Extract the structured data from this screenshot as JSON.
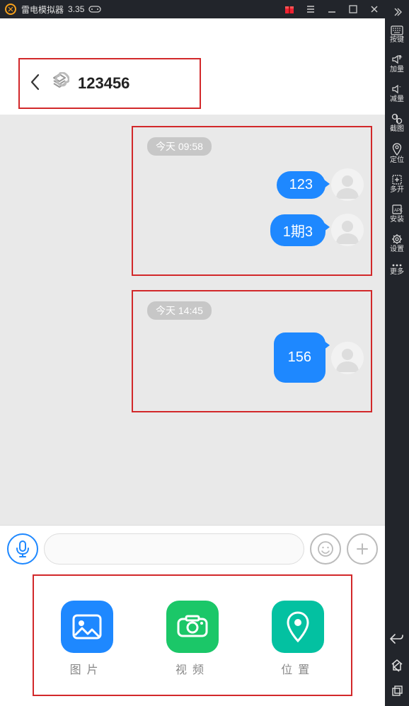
{
  "emulator": {
    "title": "雷电模拟器",
    "version": "3.35"
  },
  "sidebar": {
    "items": [
      {
        "label": "按键"
      },
      {
        "label": "加量"
      },
      {
        "label": "减量"
      },
      {
        "label": "截图"
      },
      {
        "label": "定位"
      },
      {
        "label": "多开"
      },
      {
        "label": "安装"
      },
      {
        "label": "设置"
      },
      {
        "label": "更多"
      }
    ]
  },
  "chat": {
    "title": "123456",
    "groups": [
      {
        "timestamp": "今天 09:58",
        "messages": [
          {
            "text": "123"
          },
          {
            "text": "1期3"
          }
        ]
      },
      {
        "timestamp": "今天 14:45",
        "messages": [
          {
            "text": "156",
            "big": true
          }
        ]
      }
    ]
  },
  "attachments": {
    "items": [
      {
        "label": "图片"
      },
      {
        "label": "视频"
      },
      {
        "label": "位置"
      }
    ]
  }
}
